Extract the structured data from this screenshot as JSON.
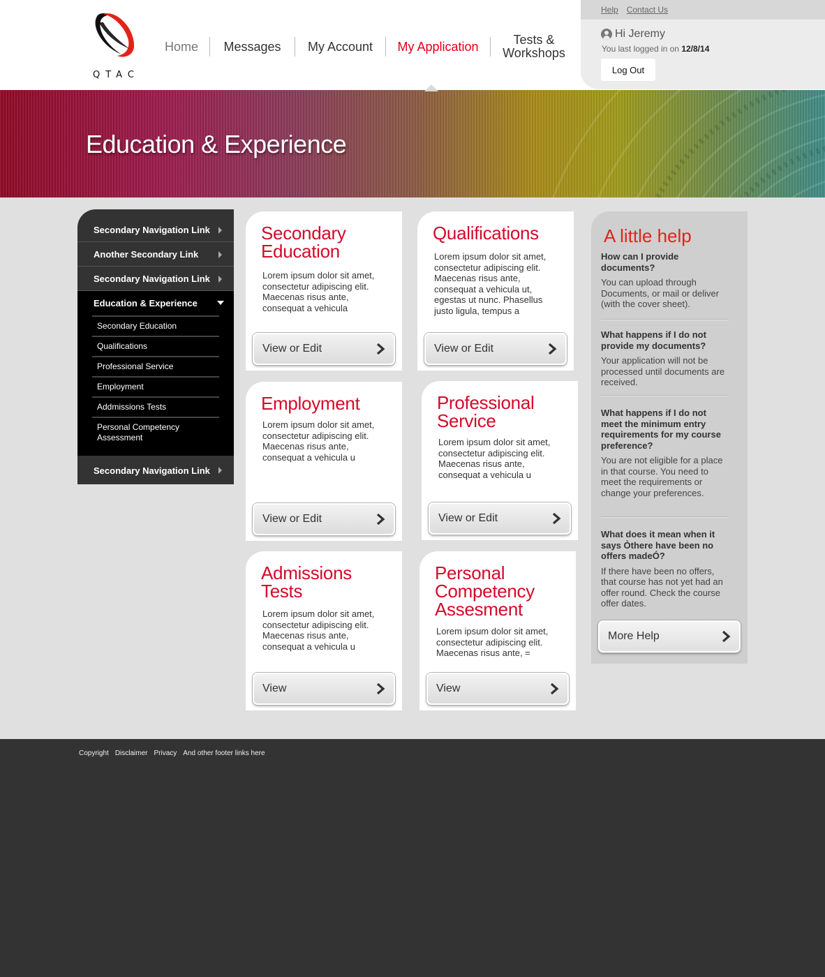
{
  "logo": {
    "text": "QTAC"
  },
  "nav": {
    "items": [
      {
        "label": "Home"
      },
      {
        "label": "Messages"
      },
      {
        "label": "My Account"
      },
      {
        "label": "My Application"
      },
      {
        "label_line1": "Tests &",
        "label_line2": "Workshops"
      }
    ]
  },
  "user": {
    "help_link": "Help",
    "contact_link": "Contact Us",
    "greeting": "Hi Jeremy",
    "last_login_prefix": "You last logged in on ",
    "last_login_date": "12/8/14",
    "logout": "Log Out"
  },
  "banner": {
    "title": "Education & Experience"
  },
  "sidenav": {
    "top_links": [
      "Secondary Navigation Link",
      "Another Secondary  Link",
      "Secondary Navigation Link"
    ],
    "active": "Education & Experience",
    "sub_items": [
      "Secondary Education",
      "Qualifications",
      "Professional Service",
      "Employment",
      "Addmissions Tests",
      "Personal Competency Assessment"
    ],
    "bottom_link": "Secondary Navigation Link"
  },
  "cards": {
    "secondary_education": {
      "title_line1": "Secondary",
      "title_line2": "Education",
      "body": "Lorem ipsum dolor sit amet, consectetur adipiscing elit. Maecenas risus ante, consequat a vehicula",
      "button": "View or Edit"
    },
    "qualifications": {
      "title": "Qualifications",
      "body": "Lorem ipsum dolor sit amet, consectetur adipiscing elit. Maecenas risus ante, consequat a vehicula ut, egestas ut nunc. Phasellus justo ligula, tempus a",
      "button": "View or Edit"
    },
    "employment": {
      "title": "Employment",
      "body": "Lorem ipsum dolor sit amet, consectetur adipiscing elit. Maecenas risus ante, consequat a vehicula u",
      "button": "View or Edit"
    },
    "professional_service": {
      "title_line1": "Professional",
      "title_line2": "Service",
      "body": "Lorem ipsum dolor sit amet, consectetur adipiscing elit. Maecenas risus ante, consequat a vehicula u",
      "button": "View or Edit"
    },
    "admissions_tests": {
      "title_line1": "Admissions",
      "title_line2": "Tests",
      "body": "Lorem ipsum dolor sit amet, consectetur adipiscing elit. Maecenas risus ante, consequat a vehicula u",
      "button": "View"
    },
    "personal_competency": {
      "title_line1": "Personal",
      "title_line2": "Competency",
      "title_line3": "Assesment",
      "body": "Lorem ipsum dolor sit amet, consectetur adipiscing elit. Maecenas risus ante, =",
      "button": "View"
    }
  },
  "help": {
    "title": "A little help",
    "faqs": [
      {
        "q": "How can I provide documents?",
        "a": "You can upload through Documents, or mail or deliver (with the cover sheet)."
      },
      {
        "q": "What happens if I do not provide my documents?",
        "a": "Your application will not be processed until documents are received."
      },
      {
        "q": "What happens if I do not meet the minimum entry requirements for my course preference?",
        "a": "You are not eligible for a place in that course. You need to meet the requirements or change your preferences."
      },
      {
        "q": "What does it mean when it says Òthere have been no offers madeÓ?",
        "a": "If there have been no offers, that course has not yet had an offer round. Check the course offer dates."
      }
    ],
    "button": "More Help"
  },
  "footer": {
    "links": [
      "Copyright",
      "Disclaimer",
      "Privacy",
      "And other footer links here"
    ]
  },
  "colors": {
    "accent_red": "#d40a2a",
    "nav_active": "#e2001a",
    "footer_bg": "#333333",
    "content_bg": "#e0e0e0"
  }
}
